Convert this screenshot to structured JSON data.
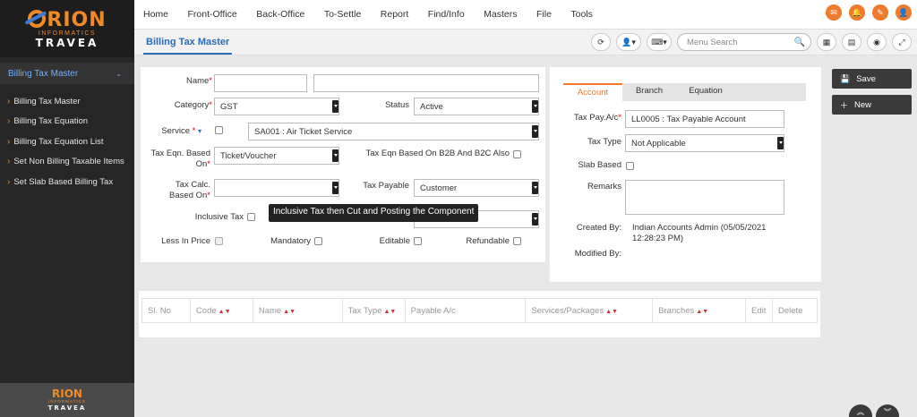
{
  "brand": {
    "name": "RION",
    "sub": "INFORMATICS",
    "tagline": "TRAVEA"
  },
  "sidebar": {
    "section": "Billing Tax Master",
    "items": [
      {
        "label": "Billing Tax Master"
      },
      {
        "label": "Billing Tax Equation"
      },
      {
        "label": "Billing Tax Equation List"
      },
      {
        "label": "Set Non Billing Taxable Items"
      },
      {
        "label": "Set Slab Based Billing Tax"
      }
    ]
  },
  "topnav": {
    "menu": [
      "Home",
      "Front-Office",
      "Back-Office",
      "To-Settle",
      "Report",
      "Find/Info",
      "Masters",
      "File",
      "Tools"
    ],
    "accent": "#f07b2c"
  },
  "subheader": {
    "title": "Billing Tax Master",
    "search_placeholder": "Menu Search"
  },
  "form": {
    "name_label": "Name",
    "name_value": "",
    "name2_value": "",
    "category_label": "Category",
    "category_value": "GST",
    "status_label": "Status",
    "status_value": "Active",
    "service_label": "Service",
    "service_value": "SA001 : Air Ticket Service",
    "tax_eqn_label": "Tax Eqn. Based",
    "tax_eqn_label2": "On",
    "tax_eqn_value": "Ticket/Voucher",
    "b2b_label": "Tax Eqn Based On B2B And B2C Also",
    "tax_calc_label": "Tax Calc.",
    "tax_calc_label2": "Based On",
    "tax_calc_value": "",
    "tax_payable_label": "Tax Payable",
    "tax_payable_value": "Customer",
    "inclusive_label": "Inclusive Tax",
    "less_in_price_label": "Less In Price",
    "mandatory_label": "Mandatory",
    "editable_label": "Editable",
    "refundable_label": "Refundable",
    "tooltip": "Inclusive Tax then Cut and Posting the Component"
  },
  "account_panel": {
    "tabs": [
      "Account",
      "Branch",
      "Equation"
    ],
    "tax_pay_ac_label": "Tax Pay.A/c",
    "tax_pay_ac_value": "LL0005 : Tax Payable Account",
    "tax_type_label": "Tax Type",
    "tax_type_value": "Not Applicable",
    "slab_based_label": "Slab Based",
    "remarks_label": "Remarks",
    "created_by_label": "Created By:",
    "created_by_value": "Indian Accounts Admin (05/05/2021 12:28:23 PM)",
    "modified_by_label": "Modified By:"
  },
  "table": {
    "columns": [
      "Sl. No",
      "Code",
      "Name",
      "Tax Type",
      "Payable A/c",
      "Services/Packages",
      "Branches",
      "Edit",
      "Delete"
    ]
  },
  "actions": {
    "save": "Save",
    "new": "New"
  }
}
